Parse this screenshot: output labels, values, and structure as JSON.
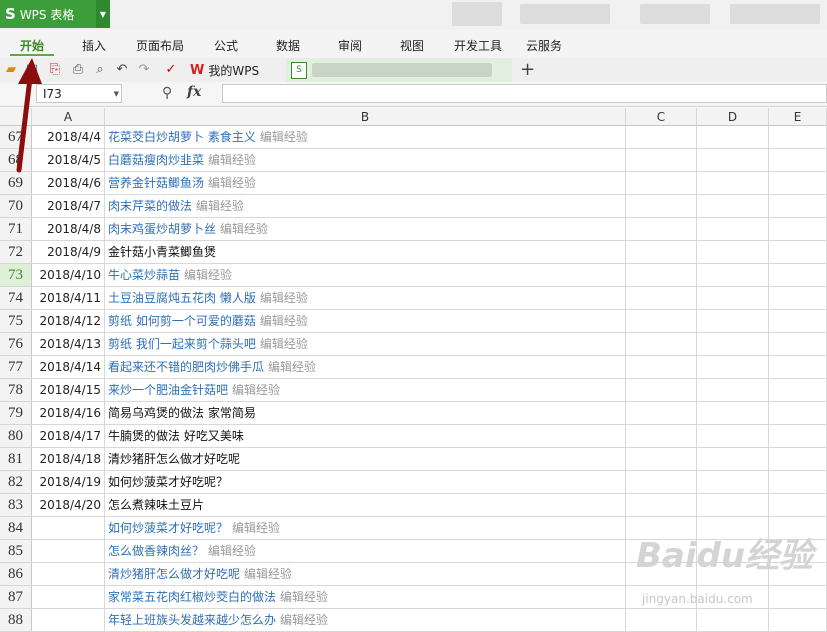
{
  "app": {
    "title": "WPS 表格",
    "logo": "S"
  },
  "menu": [
    "开始",
    "插入",
    "页面布局",
    "公式",
    "数据",
    "审阅",
    "视图",
    "开发工具",
    "云服务"
  ],
  "menu_active": "开始",
  "tabs": {
    "wps_tab": "我的WPS",
    "new_tab": "+"
  },
  "formula": {
    "cell_ref": "I73",
    "fx": "fx",
    "value": ""
  },
  "columns": [
    "A",
    "B",
    "C",
    "D",
    "E"
  ],
  "selected_row": "73",
  "edit_label": "编辑经验",
  "rows": [
    {
      "n": "67",
      "date": "2018/4/4",
      "title": "花菜茭白炒胡萝卜 素食主义",
      "link": true,
      "edit": "编辑经验"
    },
    {
      "n": "68",
      "date": "2018/4/5",
      "title": "白蘑菇瘦肉炒韭菜",
      "link": true,
      "edit": "编辑经验"
    },
    {
      "n": "69",
      "date": "2018/4/6",
      "title": "营养金针菇鲫鱼汤",
      "link": true,
      "edit": "编辑经验"
    },
    {
      "n": "70",
      "date": "2018/4/7",
      "title": "肉末芹菜的做法",
      "link": true,
      "edit": "编辑经验"
    },
    {
      "n": "71",
      "date": "2018/4/8",
      "title": "肉末鸡蛋炒胡萝卜丝",
      "link": true,
      "edit": "编辑经验"
    },
    {
      "n": "72",
      "date": "2018/4/9",
      "title": "金针菇小青菜鲫鱼煲",
      "link": false,
      "edit": ""
    },
    {
      "n": "73",
      "date": "2018/4/10",
      "title": "牛心菜炒蒜苗",
      "link": true,
      "edit": "编辑经验"
    },
    {
      "n": "74",
      "date": "2018/4/11",
      "title": "土豆油豆腐炖五花肉 懒人版",
      "link": true,
      "edit": "编辑经验"
    },
    {
      "n": "75",
      "date": "2018/4/12",
      "title": "剪纸 如何剪一个可爱的蘑菇",
      "link": true,
      "edit": "编辑经验"
    },
    {
      "n": "76",
      "date": "2018/4/13",
      "title": "剪纸 我们一起来剪个蒜头吧",
      "link": true,
      "edit": "编辑经验"
    },
    {
      "n": "77",
      "date": "2018/4/14",
      "title": "看起来还不错的肥肉炒佛手瓜",
      "link": true,
      "edit": "编辑经验"
    },
    {
      "n": "78",
      "date": "2018/4/15",
      "title": "来炒一个肥油金针菇吧",
      "link": true,
      "edit": "编辑经验"
    },
    {
      "n": "79",
      "date": "2018/4/16",
      "title": "简易乌鸡煲的做法 家常简易",
      "link": false,
      "edit": ""
    },
    {
      "n": "80",
      "date": "2018/4/17",
      "title": "牛腩煲的做法 好吃又美味",
      "link": false,
      "edit": ""
    },
    {
      "n": "81",
      "date": "2018/4/18",
      "title": "清炒猪肝怎么做才好吃呢",
      "link": false,
      "edit": ""
    },
    {
      "n": "82",
      "date": "2018/4/19",
      "title": "如何炒菠菜才好吃呢？",
      "link": false,
      "edit": ""
    },
    {
      "n": "83",
      "date": "2018/4/20",
      "title": "怎么煮辣味土豆片",
      "link": false,
      "edit": ""
    },
    {
      "n": "84",
      "date": "",
      "title": " 如何炒菠菜才好吃呢？",
      "link": true,
      "edit": "编辑经验"
    },
    {
      "n": "85",
      "date": "",
      "title": "怎么做香辣肉丝？",
      "link": true,
      "edit": "编辑经验"
    },
    {
      "n": "86",
      "date": "",
      "title": " 清炒猪肝怎么做才好吃呢",
      "link": true,
      "edit": "编辑经验"
    },
    {
      "n": "87",
      "date": "",
      "title": "家常菜五花肉红椒炒茭白的做法",
      "link": true,
      "edit": "编辑经验"
    },
    {
      "n": "88",
      "date": "",
      "title": "年轻上班族头发越来越少怎么办",
      "link": true,
      "edit": "编辑经验"
    }
  ],
  "watermark": {
    "main": "Baidu经验",
    "sub": "jingyan.baidu.com"
  },
  "colors": {
    "accent": "#3b9e3b",
    "link": "#2f6fb5",
    "arrow": "#8b0d0d"
  }
}
